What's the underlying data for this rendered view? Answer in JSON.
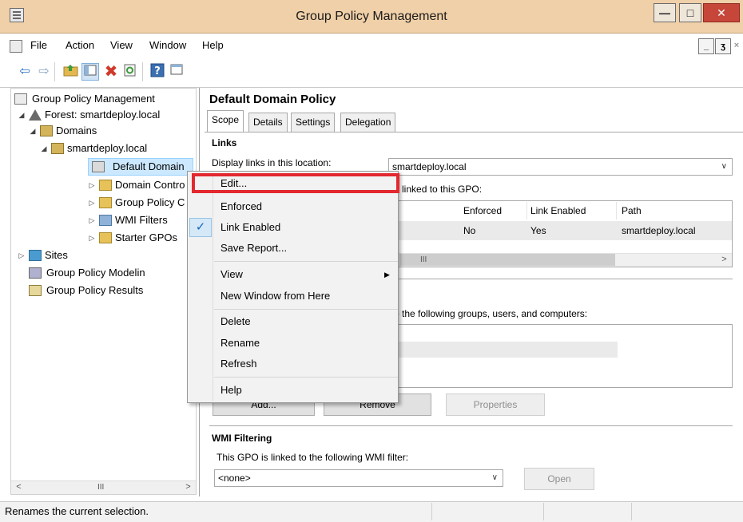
{
  "window": {
    "title": "Group Policy Management",
    "min": "—",
    "max": "□",
    "close": "✕"
  },
  "menu": {
    "items": [
      "File",
      "Action",
      "View",
      "Window",
      "Help"
    ],
    "mdi_min": "_",
    "mdi_restore": "ʒ",
    "mdi_close": "×"
  },
  "tree": {
    "root": "Group Policy Management",
    "forest": "Forest: smartdeploy.local",
    "domains": "Domains",
    "domain": "smartdeploy.local",
    "default_domain": "Default Domain",
    "domain_controllers": "Domain Contro",
    "gpo_objects": "Group Policy C",
    "wmi_filters": "WMI Filters",
    "starter_gpos": "Starter GPOs",
    "sites": "Sites",
    "modeling": "Group Policy Modelin",
    "results": "Group Policy Results",
    "scroll_thumb": "III"
  },
  "details": {
    "title": "Default Domain Policy",
    "tabs": [
      "Scope",
      "Details",
      "Settings",
      "Delegation"
    ],
    "links_heading": "Links",
    "display_links_label": "Display links in this location:",
    "location_value": "smartdeploy.local",
    "linked_text": "e linked to this GPO:",
    "columns": [
      "Enforced",
      "Link Enabled",
      "Path"
    ],
    "row": {
      "enforced": "No",
      "link_enabled": "Yes",
      "path": "smartdeploy.local"
    },
    "grid_scroll_thumb": "III",
    "security_text": "o the following groups, users, and computers:",
    "add_button": "Add...",
    "remove_button": "Remove",
    "properties_button": "Properties",
    "wmi_heading": "WMI Filtering",
    "wmi_text": "This GPO is linked to the following WMI filter:",
    "wmi_value": "<none>",
    "open_button": "Open"
  },
  "context_menu": {
    "items": [
      "Edit...",
      "Enforced",
      "Link Enabled",
      "Save Report...",
      "View",
      "New Window from Here",
      "Delete",
      "Rename",
      "Refresh",
      "Help"
    ],
    "checked_item": "Link Enabled",
    "highlighted_item": "Edit...",
    "highlight_color": "#e3282f"
  },
  "status": {
    "text": "Renames the current selection."
  }
}
